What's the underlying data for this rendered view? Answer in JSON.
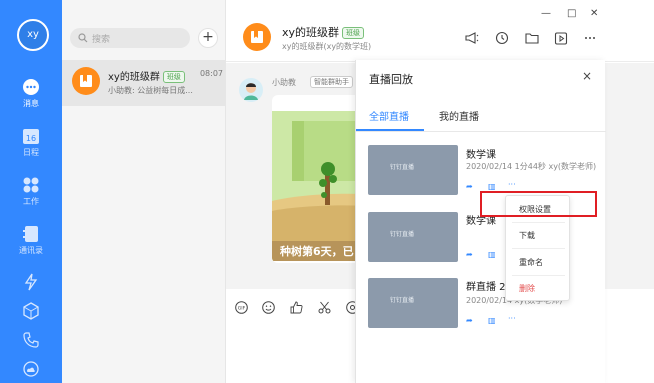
{
  "rail": {
    "avatar_text": "xy",
    "items": [
      {
        "label": "消息",
        "icon": "chat-bubble-icon"
      },
      {
        "label": "日程",
        "icon": "calendar-icon"
      },
      {
        "label": "工作",
        "icon": "apps-grid-icon"
      },
      {
        "label": "通讯录",
        "icon": "contacts-icon"
      }
    ],
    "calendar_day": "16",
    "bottom_icons": [
      "lightning-icon",
      "cube-icon",
      "phone-call-icon",
      "cloud-icon"
    ]
  },
  "conversations": {
    "search_placeholder": "搜索",
    "add_label": "+",
    "items": [
      {
        "name": "xy的班级群",
        "tag": "班级",
        "time": "08:07",
        "preview": "小助教: 公益树每日成..."
      }
    ]
  },
  "chat": {
    "title": "xy的班级群",
    "title_tag": "班级",
    "subtitle": "xy的班级群(xy的数学班)",
    "bot_name": "小助教",
    "bot_tag": "智能群助手",
    "card_caption": "种树第6天，已"
  },
  "panel": {
    "title": "直播回放",
    "close": "×",
    "tabs": [
      "全部直播",
      "我的直播"
    ],
    "videos": [
      {
        "title": "数学课",
        "meta": "2020/02/14 1分44秒 xy(数学老师)"
      },
      {
        "title": "数学课",
        "meta": ""
      },
      {
        "title": "群直播 20",
        "meta": "2020/02/14 xy(数学老师)"
      }
    ],
    "thumb_text": "钉钉直播"
  },
  "menu": {
    "items": [
      "权限设置",
      "下载",
      "重命名",
      "删除"
    ]
  },
  "colors": {
    "brand": "#3388ff",
    "orange": "#ff8c1a",
    "danger": "#e34d4d",
    "highlight": "#e01e24"
  }
}
